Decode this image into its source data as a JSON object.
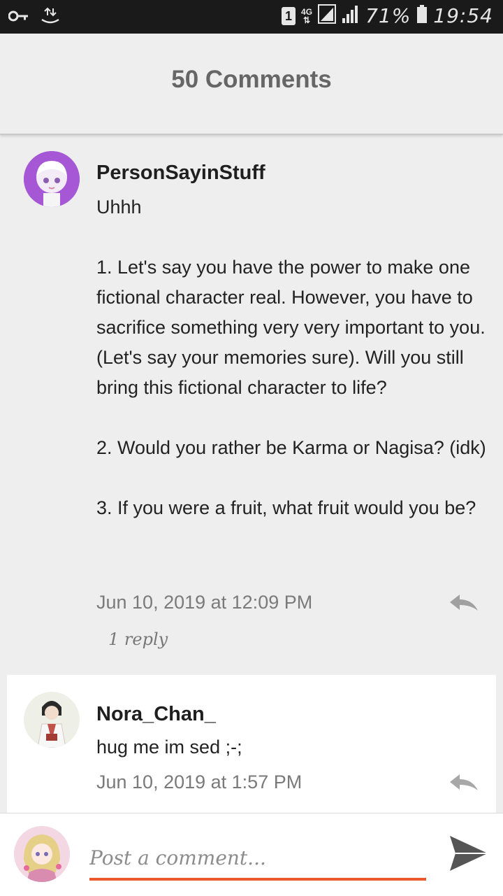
{
  "status_bar": {
    "sim_slot": "1",
    "network": "4G",
    "battery": "71%",
    "time": "19:54"
  },
  "header": {
    "title": "50 Comments"
  },
  "comments": [
    {
      "author": "PersonSayinStuff",
      "body": "Uhhh\n\n1. Let's say you have the power to make one fictional character real. However, you have to sacrifice something very very important to you. (Let's say your memories sure). Will you still bring this fictional character to life?\n\n2. Would you rather be Karma or Nagisa? (idk)\n\n3. If you were a fruit, what fruit would you be?",
      "timestamp": "Jun 10, 2019 at 12:09 PM",
      "reply_count": "1 reply"
    }
  ],
  "replies": [
    {
      "author": "Nora_Chan_",
      "body": "hug me im sed ;-;",
      "timestamp": "Jun 10, 2019 at 1:57 PM"
    }
  ],
  "compose": {
    "placeholder": "Post a comment..."
  },
  "colors": {
    "accent": "#e8592b",
    "background": "#eeeeee",
    "status_bar": "#1a1a1a"
  },
  "icons": [
    "key-icon",
    "data-transfer-icon",
    "sim-icon",
    "signal-icon",
    "battery-icon",
    "reply-icon",
    "send-icon"
  ]
}
